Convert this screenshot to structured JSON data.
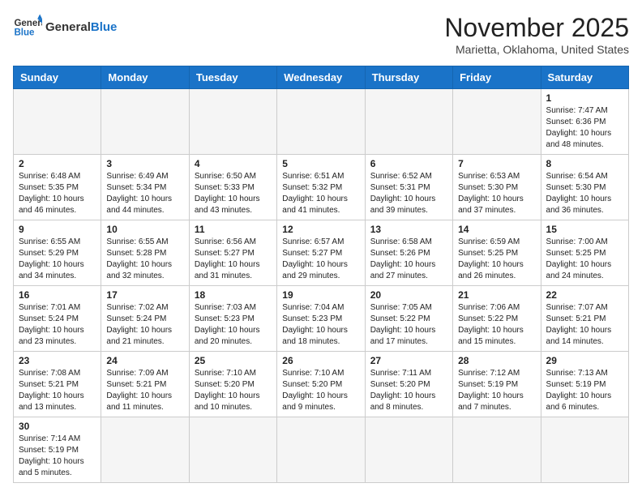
{
  "logo": {
    "general": "General",
    "blue": "Blue"
  },
  "header": {
    "month": "November 2025",
    "location": "Marietta, Oklahoma, United States"
  },
  "weekdays": [
    "Sunday",
    "Monday",
    "Tuesday",
    "Wednesday",
    "Thursday",
    "Friday",
    "Saturday"
  ],
  "weeks": [
    [
      {
        "day": "",
        "info": ""
      },
      {
        "day": "",
        "info": ""
      },
      {
        "day": "",
        "info": ""
      },
      {
        "day": "",
        "info": ""
      },
      {
        "day": "",
        "info": ""
      },
      {
        "day": "",
        "info": ""
      },
      {
        "day": "1",
        "info": "Sunrise: 7:47 AM\nSunset: 6:36 PM\nDaylight: 10 hours and 48 minutes."
      }
    ],
    [
      {
        "day": "2",
        "info": "Sunrise: 6:48 AM\nSunset: 5:35 PM\nDaylight: 10 hours and 46 minutes."
      },
      {
        "day": "3",
        "info": "Sunrise: 6:49 AM\nSunset: 5:34 PM\nDaylight: 10 hours and 44 minutes."
      },
      {
        "day": "4",
        "info": "Sunrise: 6:50 AM\nSunset: 5:33 PM\nDaylight: 10 hours and 43 minutes."
      },
      {
        "day": "5",
        "info": "Sunrise: 6:51 AM\nSunset: 5:32 PM\nDaylight: 10 hours and 41 minutes."
      },
      {
        "day": "6",
        "info": "Sunrise: 6:52 AM\nSunset: 5:31 PM\nDaylight: 10 hours and 39 minutes."
      },
      {
        "day": "7",
        "info": "Sunrise: 6:53 AM\nSunset: 5:30 PM\nDaylight: 10 hours and 37 minutes."
      },
      {
        "day": "8",
        "info": "Sunrise: 6:54 AM\nSunset: 5:30 PM\nDaylight: 10 hours and 36 minutes."
      }
    ],
    [
      {
        "day": "9",
        "info": "Sunrise: 6:55 AM\nSunset: 5:29 PM\nDaylight: 10 hours and 34 minutes."
      },
      {
        "day": "10",
        "info": "Sunrise: 6:55 AM\nSunset: 5:28 PM\nDaylight: 10 hours and 32 minutes."
      },
      {
        "day": "11",
        "info": "Sunrise: 6:56 AM\nSunset: 5:27 PM\nDaylight: 10 hours and 31 minutes."
      },
      {
        "day": "12",
        "info": "Sunrise: 6:57 AM\nSunset: 5:27 PM\nDaylight: 10 hours and 29 minutes."
      },
      {
        "day": "13",
        "info": "Sunrise: 6:58 AM\nSunset: 5:26 PM\nDaylight: 10 hours and 27 minutes."
      },
      {
        "day": "14",
        "info": "Sunrise: 6:59 AM\nSunset: 5:25 PM\nDaylight: 10 hours and 26 minutes."
      },
      {
        "day": "15",
        "info": "Sunrise: 7:00 AM\nSunset: 5:25 PM\nDaylight: 10 hours and 24 minutes."
      }
    ],
    [
      {
        "day": "16",
        "info": "Sunrise: 7:01 AM\nSunset: 5:24 PM\nDaylight: 10 hours and 23 minutes."
      },
      {
        "day": "17",
        "info": "Sunrise: 7:02 AM\nSunset: 5:24 PM\nDaylight: 10 hours and 21 minutes."
      },
      {
        "day": "18",
        "info": "Sunrise: 7:03 AM\nSunset: 5:23 PM\nDaylight: 10 hours and 20 minutes."
      },
      {
        "day": "19",
        "info": "Sunrise: 7:04 AM\nSunset: 5:23 PM\nDaylight: 10 hours and 18 minutes."
      },
      {
        "day": "20",
        "info": "Sunrise: 7:05 AM\nSunset: 5:22 PM\nDaylight: 10 hours and 17 minutes."
      },
      {
        "day": "21",
        "info": "Sunrise: 7:06 AM\nSunset: 5:22 PM\nDaylight: 10 hours and 15 minutes."
      },
      {
        "day": "22",
        "info": "Sunrise: 7:07 AM\nSunset: 5:21 PM\nDaylight: 10 hours and 14 minutes."
      }
    ],
    [
      {
        "day": "23",
        "info": "Sunrise: 7:08 AM\nSunset: 5:21 PM\nDaylight: 10 hours and 13 minutes."
      },
      {
        "day": "24",
        "info": "Sunrise: 7:09 AM\nSunset: 5:21 PM\nDaylight: 10 hours and 11 minutes."
      },
      {
        "day": "25",
        "info": "Sunrise: 7:10 AM\nSunset: 5:20 PM\nDaylight: 10 hours and 10 minutes."
      },
      {
        "day": "26",
        "info": "Sunrise: 7:10 AM\nSunset: 5:20 PM\nDaylight: 10 hours and 9 minutes."
      },
      {
        "day": "27",
        "info": "Sunrise: 7:11 AM\nSunset: 5:20 PM\nDaylight: 10 hours and 8 minutes."
      },
      {
        "day": "28",
        "info": "Sunrise: 7:12 AM\nSunset: 5:19 PM\nDaylight: 10 hours and 7 minutes."
      },
      {
        "day": "29",
        "info": "Sunrise: 7:13 AM\nSunset: 5:19 PM\nDaylight: 10 hours and 6 minutes."
      }
    ],
    [
      {
        "day": "30",
        "info": "Sunrise: 7:14 AM\nSunset: 5:19 PM\nDaylight: 10 hours and 5 minutes."
      },
      {
        "day": "",
        "info": ""
      },
      {
        "day": "",
        "info": ""
      },
      {
        "day": "",
        "info": ""
      },
      {
        "day": "",
        "info": ""
      },
      {
        "day": "",
        "info": ""
      },
      {
        "day": "",
        "info": ""
      }
    ]
  ]
}
